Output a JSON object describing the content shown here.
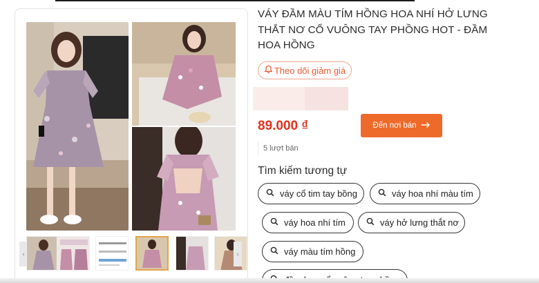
{
  "product": {
    "title": "VÁY ĐẦM MÀU TÍM HỒNG HOA NHÍ HỞ LƯNG THẮT NƠ CỔ VUÔNG TAY PHỒNG HOT - ĐẦM HOA HỒNG",
    "follow_label": "Theo dõi giảm giá",
    "price": "89.000 ₫",
    "buy_label": "Đến nơi bán",
    "sold_label": "5 lượt bán"
  },
  "similar": {
    "heading": "Tìm kiếm tương tự",
    "chips": [
      "váy cổ tim tay bồng",
      "váy hoa nhí màu tím",
      "váy hoa nhí tím",
      "váy hở lưng thắt nơ",
      "váy màu tím hồng",
      "đầm hoa cổ vuông tay phồng"
    ]
  },
  "colors": {
    "accent": "#ee6a2a",
    "price": "#e4301c",
    "follow": "#ec5a2f"
  },
  "icons": {
    "follow": "bell-icon",
    "buy": "arrow-right-icon",
    "chip": "search-icon"
  }
}
